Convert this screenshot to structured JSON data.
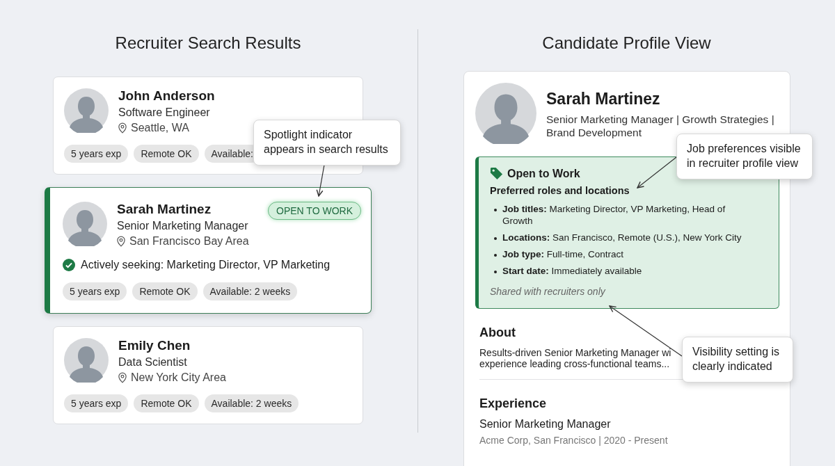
{
  "search_results": {
    "title": "Recruiter Search Results",
    "candidates": [
      {
        "name": "John Anderson",
        "title": "Software Engineer",
        "location": "Seattle, WA",
        "selected": false,
        "tags": [
          "5 years exp",
          "Remote OK",
          "Available:"
        ]
      },
      {
        "name": "Sarah Martinez",
        "title": "Senior Marketing Manager",
        "location": "San Francisco Bay Area",
        "selected": true,
        "badge": "OPEN TO WORK",
        "seeking": "Actively seeking: Marketing Director, VP Marketing",
        "tags": [
          "5 years exp",
          "Remote OK",
          "Available: 2 weeks"
        ]
      },
      {
        "name": "Emily Chen",
        "title": "Data Scientist",
        "location": "New York City Area",
        "selected": false,
        "tags": [
          "5 years exp",
          "Remote OK",
          "Available: 2 weeks"
        ]
      }
    ]
  },
  "profile_view": {
    "title": "Candidate Profile View",
    "name": "Sarah Martinez",
    "headline": "Senior Marketing Manager | Growth Strategies | Brand Development",
    "open_to_work": {
      "title": "Open to Work",
      "subtitle": "Preferred roles and locations",
      "items": [
        "**Job titles:** Marketing Director, VP Marketing, Head of Growth",
        "**Locations:** San Francisco, Remote (U.S.), New York City",
        "**Job type:** Full-time, Contract",
        "**Start date:** Immediately available"
      ],
      "note": "Shared with recruiters only"
    },
    "about": {
      "heading": "About",
      "lines": [
        "Results-driven Senior Marketing Manager wi",
        "experience leading cross-functional teams..."
      ]
    },
    "experience": {
      "heading": "Experience",
      "role": "Senior Marketing Manager",
      "company": "Acme Corp, San Francisco | 2020 - Present"
    }
  },
  "callouts": [
    "Spotlight indicator appears in search results",
    "Job preferences visible in recruiter profile view",
    "Visibility setting is clearly indicated"
  ]
}
